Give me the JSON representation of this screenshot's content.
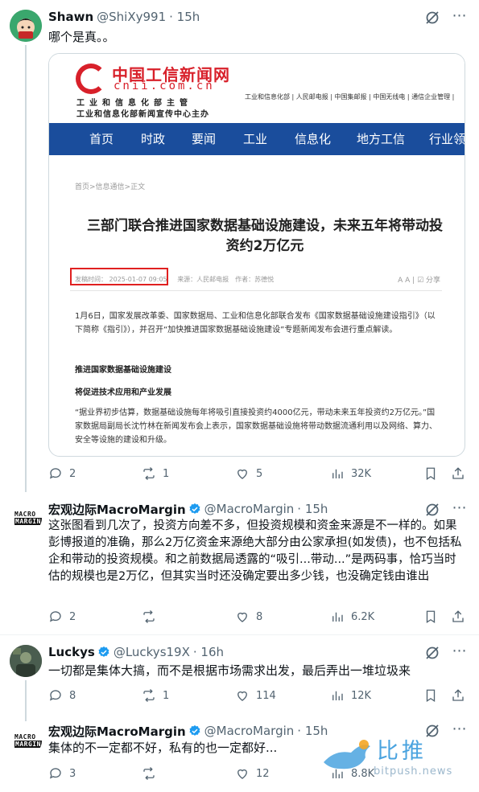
{
  "tweets": [
    {
      "name": "Shawn",
      "handle": "@ShiXy991",
      "time": "· 15h",
      "verified": false,
      "text": "哪个是真。。",
      "stats": {
        "replies": "2",
        "reposts": "1",
        "likes": "5",
        "views": "32K"
      }
    },
    {
      "name": "宏观边际MacroMargin",
      "handle": "@MacroMargin",
      "time": "· 15h",
      "verified": true,
      "text": "这张图看到几次了，投资方向差不多，但投资规模和资金来源是不一样的。如果彭博报道的准确，那么2万亿资金来源绝大部分由公家承担(如发债)，也不包括私企和带动的投资规模。和之前数据局透露的“吸引...带动...”是两码事，恰巧当时估的规模也是2万亿，但其实当时还没确定要出多少钱，也没确定钱由谁出",
      "stats": {
        "replies": "2",
        "reposts": "",
        "likes": "8",
        "views": "6.2K"
      }
    },
    {
      "name": "Luckys",
      "handle": "@Luckys19X",
      "time": "· 16h",
      "verified": true,
      "text": "一切都是集体大搞，而不是根据市场需求出发，最后弄出一堆垃圾来",
      "stats": {
        "replies": "8",
        "reposts": "1",
        "likes": "114",
        "views": "12K"
      }
    },
    {
      "name": "宏观边际MacroMargin",
      "handle": "@MacroMargin",
      "time": "· 15h",
      "verified": true,
      "text": "集体的不一定都不好，私有的也一定都好...",
      "stats": {
        "replies": "3",
        "reposts": "",
        "likes": "12",
        "views": "8.8K"
      }
    }
  ],
  "avatar_macro": {
    "line1": "MACRO",
    "line2": "MARGIN"
  },
  "article": {
    "site_title": "中国工信新闻网",
    "site_domain": "cnii.com.cn",
    "site_sub1": "工业和信息化部主管",
    "site_sub2": "工业和信息化部新闻宣传中心主办",
    "top_links": "工业和信息化部 | 人民邮电报 | 中国集邮报 | 中国无线电 | 通信企业管理 |",
    "nav": [
      "首页",
      "时政",
      "要闻",
      "工业",
      "信息化",
      "地方工信",
      "行业领"
    ],
    "breadcrumb": "首页>信息通信>正文",
    "title": "三部门联合推进国家数据基础设施建设，未来五年将带动投资约2万亿元",
    "meta_time": "发稿时间： 2025-01-07 09:05",
    "meta_source": "来源：人民邮电报　作者：苏德悦",
    "meta_tools": "A A | ☑ 分享",
    "para1": "1月6日，国家发展改革委、国家数据局、工业和信息化部联合发布《国家数据基础设施建设指引》（以下简称《指引》），并召开“加快推进国家数据基础设施建设”专题新闻发布会进行重点解读。",
    "sub1": "推进国家数据基础设施建设",
    "sub2": "将促进技术应用和产业发展",
    "para2": "“据业界初步估算，数据基础设施每年将吸引直接投资约4000亿元，带动未来五年投资约2万亿元。”国家数据局副局长沈竹林在新闻发布会上表示，国家数据基础设施将带动数据流通利用以及网络、算力、安全等设施的建设和升级。"
  },
  "watermark": {
    "text": "比推",
    "url": "bitpush.news"
  },
  "colors": {
    "text": "#0f1419",
    "muted": "#536471",
    "verified": "#1d9bf0",
    "nav": "#1a4d9c",
    "brand_red": "#d8202a"
  }
}
